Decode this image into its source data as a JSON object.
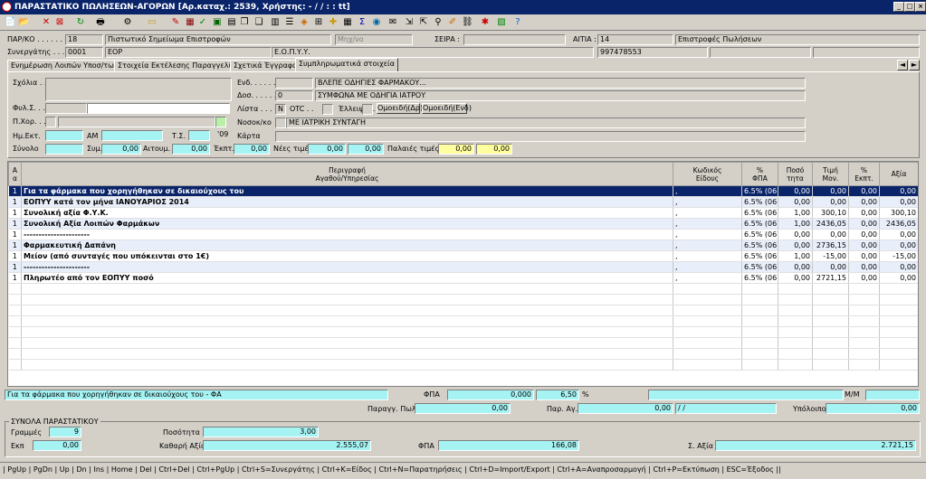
{
  "window": {
    "title": "ΠΑΡΑΣΤΑΤΙΚΟ ΠΩΛΗΣΕΩΝ-ΑΓΟΡΩΝ [Αρ.καταχ.: 2539, Χρήστης: -  / /    :  :  tt]"
  },
  "header": {
    "par_label": "ΠΑΡ/ΚΟ . . . . . . .",
    "par_code": "18",
    "par_name": "Πιστωτικό Σημείωμα Επιστροφών",
    "mode": "Μηχ/νο",
    "series_label": "ΣΕΙΡΑ :",
    "reason_label": "ΑΙΤΙΑ :",
    "reason_code": "14",
    "reason_name": "Επιστροφές Πωλήσεων",
    "partner_label": "Συνεργάτης . . .",
    "partner_code": "0001",
    "partner_name": "EOP",
    "partner_org": "Ε.Ο.Π.Υ.Υ.",
    "partner_afm": "997478553"
  },
  "tabs": [
    "Ενημέρωση Λοιπών Υποσ/των",
    "Στοιχεία Εκτέλεσης Παραγγελίας",
    "Σχετικά Έγγραφα",
    "Συμπληρωματικά στοιχεία"
  ],
  "tab_arrows": [
    "◄",
    "►"
  ],
  "supp": {
    "comments_label": "Σχόλια . .",
    "fyl_label": "Φυλ.Σ. . .",
    "pxor_label": "Π.Χορ. . .",
    "date_label": "Ημ.Εκτ.",
    "am_label": "ΑΜ",
    "ts_label": "Τ.Σ.",
    "ts_value": "'09",
    "total_label": "Σύνολο",
    "total_value": "0,00",
    "sym_label": "Συμ.",
    "sym_value": "0,00",
    "aitoum_label": "Αιτουμ.",
    "aitoum_value": "0,00",
    "ekpt_label": "Έκπτ.",
    "ekpt_value": "0,00",
    "new_prices_label": "Νέες τιμές",
    "new_price1": "0,00",
    "new_price2": "0,00",
    "old_prices_label": "Παλαιές τιμές",
    "old_price1": "0,00",
    "old_price2": "0,00",
    "end_label": "Ενδ. . . . . .",
    "end_value": "ΒΛΕΠΕ ΟΔΗΓΙΕΣ ΦΑΡΜΑΚΟΥ...",
    "dos_label": "Δοσ. . . . . .",
    "dos_code": "0",
    "dos_value": "ΣΥΜΦΩΝΑ ΜΕ ΟΔΗΓΙΑ ΙΑΤΡΟΥ",
    "list_label": "Λίστα . . .",
    "list_value": "N",
    "otc_label": "OTC . .",
    "elleipsi_label": "Έλλειψη. .",
    "omoeid_dr": "Ομοειδή(Δρ)",
    "omoeid_end": "Ομοειδή(Ενδ)",
    "nosok_label": "Νοσοκ/κο",
    "nosok_value": "ΜΕ ΙΑΤΡΙΚΗ ΣΥΝΤΑΓΗ",
    "karta_label": "Κάρτα"
  },
  "grid": {
    "columns": [
      "Α\nα",
      "Περιγραφή\nΑγαθού/Υπηρεσίας",
      "Κωδικός\nΕίδους",
      "%\nΦΠΑ",
      "Ποσό\nτητα",
      "Τιμή\nΜον.",
      "%\nΕκπτ.",
      "Αξία"
    ],
    "rows": [
      {
        "aa": "1",
        "desc": "Για τα φάρμακα που χορηγήθηκαν σε δικαιούχους του",
        "code": ",",
        "fpa": "6.5% (06)",
        "qty": "0,00",
        "price": "0,00",
        "disc": "0,00",
        "value": "0,00"
      },
      {
        "aa": "1",
        "desc": "ΕΟΠΥΥ κατά τον μήνα ΙΑΝΟΥΑΡΙΟΣ 2014",
        "code": ",",
        "fpa": "6.5% (06)",
        "qty": "0,00",
        "price": "0,00",
        "disc": "0,00",
        "value": "0,00"
      },
      {
        "aa": "1",
        "desc": "Συνολική αξία Φ.Υ.Κ.",
        "code": ",",
        "fpa": "6.5% (06)",
        "qty": "1,00",
        "price": "300,10",
        "disc": "0,00",
        "value": "300,10"
      },
      {
        "aa": "1",
        "desc": "Συνολική Αξία Λοιπών Φαρμάκων",
        "code": ",",
        "fpa": "6.5% (06)",
        "qty": "1,00",
        "price": "2436,05",
        "disc": "0,00",
        "value": "2436,05"
      },
      {
        "aa": "1",
        "desc": "----------------------",
        "code": ",",
        "fpa": "6.5% (06)",
        "qty": "0,00",
        "price": "0,00",
        "disc": "0,00",
        "value": "0,00"
      },
      {
        "aa": "1",
        "desc": "Φαρμακευτική Δαπάνη",
        "code": ",",
        "fpa": "6.5% (06)",
        "qty": "0,00",
        "price": "2736,15",
        "disc": "0,00",
        "value": "0,00"
      },
      {
        "aa": "1",
        "desc": "Μείον (από συνταγές που υπόκεινται στο 1€)",
        "code": ",",
        "fpa": "6.5% (06)",
        "qty": "1,00",
        "price": "-15,00",
        "disc": "0,00",
        "value": "-15,00"
      },
      {
        "aa": "1",
        "desc": "----------------------",
        "code": ",",
        "fpa": "6.5% (06)",
        "qty": "0,00",
        "price": "0,00",
        "disc": "0,00",
        "value": "0,00"
      },
      {
        "aa": "1",
        "desc": "Πληρωτέο από τον ΕΟΠΥΥ ποσό",
        "code": ",",
        "fpa": "6.5% (06)",
        "qty": "0,00",
        "price": "2721,15",
        "disc": "0,00",
        "value": "0,00"
      }
    ]
  },
  "footer": {
    "desc_value": "Για τα φάρμακα που χορηγήθηκαν σε δικαιούχους του  - ΦΑ",
    "fpa_label": "ΦΠΑ",
    "fpa_value": "0,000",
    "fpa_rate": "6,50",
    "pct": "%",
    "mm_label": "Μ/Μ",
    "parag_pol_label": "Παραγγ. Πωλ.",
    "parag_pol_value": "0,00",
    "par_ag_label": "Παρ. Αγ.",
    "par_ag_value": "0,00",
    "date_value": "/ /",
    "ypoloipo_label": "Υπόλοιπο",
    "ypoloipo_value": "0,00"
  },
  "totals": {
    "group_label": "ΣΥΝΟΛΑ ΠΑΡΑΣΤΑΤΙΚΟΥ",
    "lines_label": "Γραμμές",
    "lines_value": "9",
    "qty_label": "Ποσότητα",
    "qty_value": "3,00",
    "ekpt_label": "Εκπ",
    "ekpt_value": "0,00",
    "net_label": "Καθαρή Αξία",
    "net_value": "2.555,07",
    "fpa_label": "ΦΠΑ",
    "fpa_value": "166,08",
    "total_label": "Σ. Αξία",
    "total_value": "2.721,15"
  },
  "statusbar": "| PgUp | PgDn | Up | Dn | Ins | Home | Del | Ctrl+Del | Ctrl+PgUp | Ctrl+S=Συνεργάτης | Ctrl+K=Είδος | Ctrl+N=Παρατηρήσεις | Ctrl+D=Import/Export | Ctrl+A=Αναπροσαρμογή | Ctrl+P=Εκτύπωση | ESC=Έξοδος ||",
  "title_buttons": [
    "_",
    "□",
    "×"
  ]
}
